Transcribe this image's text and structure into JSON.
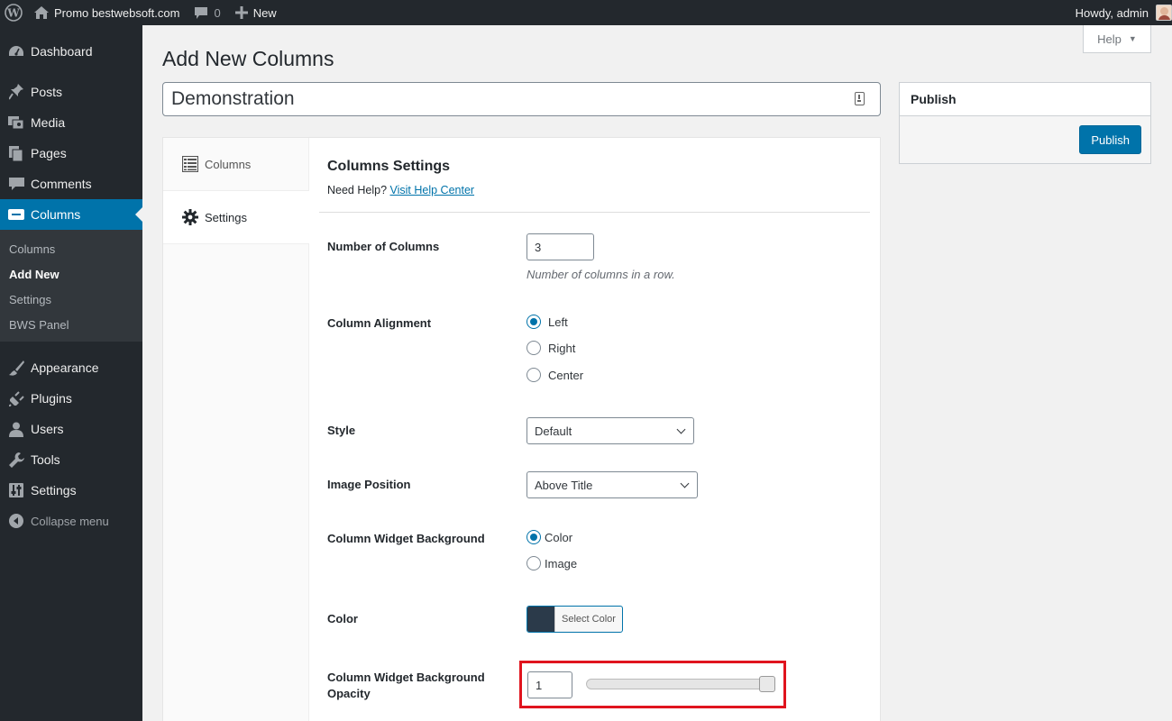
{
  "adminbar": {
    "site_name": "Promo bestwebsoft.com",
    "comments_count": "0",
    "new_label": "New",
    "howdy": "Howdy, admin"
  },
  "sidebar": {
    "items_top": [
      {
        "label": "Dashboard",
        "icon": "dashboard-icon"
      },
      {
        "label": "Posts",
        "icon": "pin-icon"
      },
      {
        "label": "Media",
        "icon": "media-icon"
      },
      {
        "label": "Pages",
        "icon": "pages-icon"
      },
      {
        "label": "Comments",
        "icon": "comment-icon"
      },
      {
        "label": "Columns",
        "icon": "columns-icon"
      }
    ],
    "submenu": [
      "Columns",
      "Add New",
      "Settings",
      "BWS Panel"
    ],
    "items_bottom": [
      {
        "label": "Appearance",
        "icon": "brush-icon"
      },
      {
        "label": "Plugins",
        "icon": "plugin-icon"
      },
      {
        "label": "Users",
        "icon": "user-icon"
      },
      {
        "label": "Tools",
        "icon": "wrench-icon"
      },
      {
        "label": "Settings",
        "icon": "sliders-icon"
      }
    ],
    "collapse_label": "Collapse menu"
  },
  "header": {
    "help_label": "Help",
    "page_title": "Add New Columns",
    "title_value": "Demonstration"
  },
  "tabs": [
    {
      "label": "Columns",
      "icon": "list-icon"
    },
    {
      "label": "Settings",
      "icon": "gear-icon"
    }
  ],
  "settings": {
    "section_title": "Columns Settings",
    "need_help": "Need Help?",
    "help_link": "Visit Help Center",
    "num_columns_label": "Number of Columns",
    "num_columns_value": "3",
    "num_columns_desc": "Number of columns in a row.",
    "alignment_label": "Column Alignment",
    "alignment_options": [
      "Left",
      "Right",
      "Center"
    ],
    "alignment_selected": "Left",
    "style_label": "Style",
    "style_value": "Default",
    "image_position_label": "Image Position",
    "image_position_value": "Above Title",
    "bg_label": "Column Widget Background",
    "bg_options": [
      "Color",
      "Image"
    ],
    "bg_selected": "Color",
    "color_label": "Color",
    "color_value": "#2b3a4a",
    "select_color_label": "Select Color",
    "opacity_label": "Column Widget Background Opacity",
    "opacity_value": "1",
    "opacity_slider_level": 1.0
  },
  "publish": {
    "box_title": "Publish",
    "button_label": "Publish"
  },
  "colors": {
    "accent": "#0073aa",
    "sidebar_bg": "#23282d",
    "highlight": "#e0141e"
  }
}
